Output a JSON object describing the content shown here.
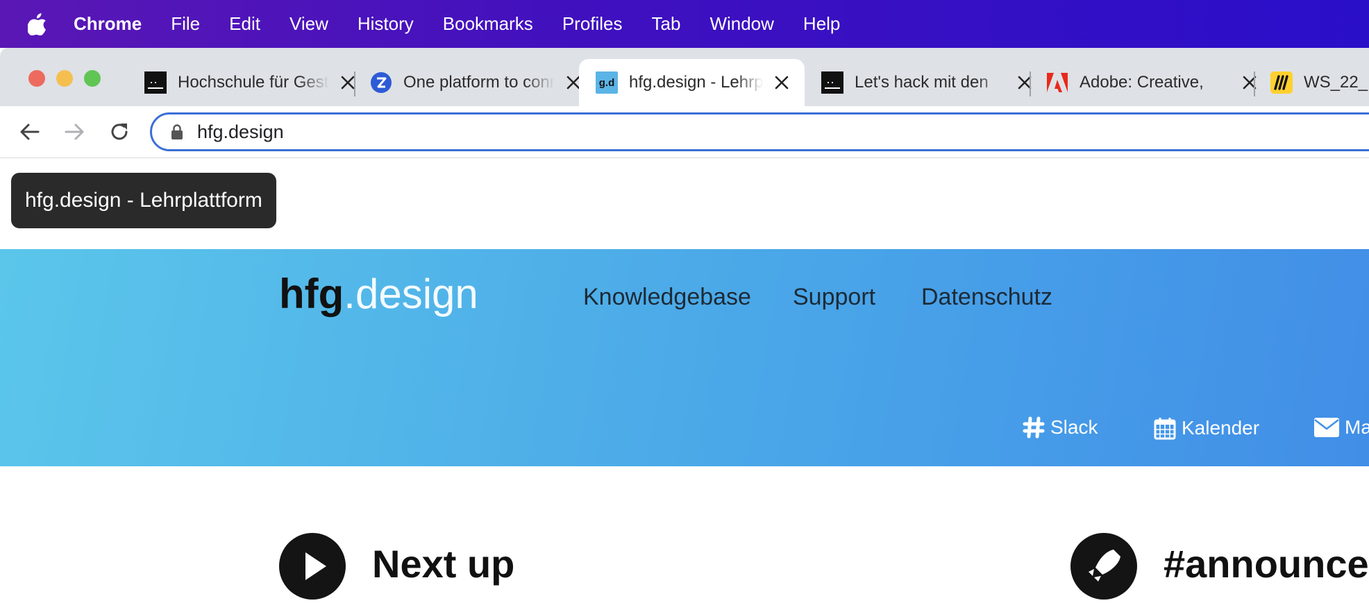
{
  "menubar": {
    "app": "Chrome",
    "items": [
      "File",
      "Edit",
      "View",
      "History",
      "Bookmarks",
      "Profiles",
      "Tab",
      "Window",
      "Help"
    ]
  },
  "tabs": [
    {
      "title": "Hochschule für Gestaltung",
      "favicon": "terminal-icon",
      "active": false
    },
    {
      "title": "One platform to connect",
      "favicon": "zoom-icon",
      "active": false
    },
    {
      "title": "hfg.design - Lehrplattform",
      "favicon": "hfg-design-icon",
      "favicon_text": "g.d",
      "active": true
    },
    {
      "title": "Let's hack mit den",
      "favicon": "terminal-icon",
      "active": false
    },
    {
      "title": "Adobe: Creative,",
      "favicon": "adobe-icon",
      "active": false
    },
    {
      "title": "WS_22_",
      "favicon": "miro-icon",
      "active": false
    }
  ],
  "omnibox": {
    "url": "hfg.design"
  },
  "tooltip": {
    "text": "hfg.design - Lehrplattform"
  },
  "site": {
    "logo_bold": "hfg",
    "logo_light": ".design",
    "nav": [
      "Knowledgebase",
      "Support",
      "Datenschutz"
    ],
    "quick_links": [
      {
        "label": "Slack",
        "icon": "slack-icon"
      },
      {
        "label": "Kalender",
        "icon": "calendar-icon"
      },
      {
        "label": "Ma",
        "icon": "mail-icon"
      }
    ]
  },
  "sections": [
    {
      "title": "Next up",
      "icon": "play-icon"
    },
    {
      "title": "#announce",
      "icon": "rocket-icon"
    }
  ],
  "colors": {
    "menubar": "#3f10bf",
    "hero_start": "#5bc6ea",
    "hero_end": "#418ee7",
    "omnibox_focus": "#3a6fd6"
  }
}
